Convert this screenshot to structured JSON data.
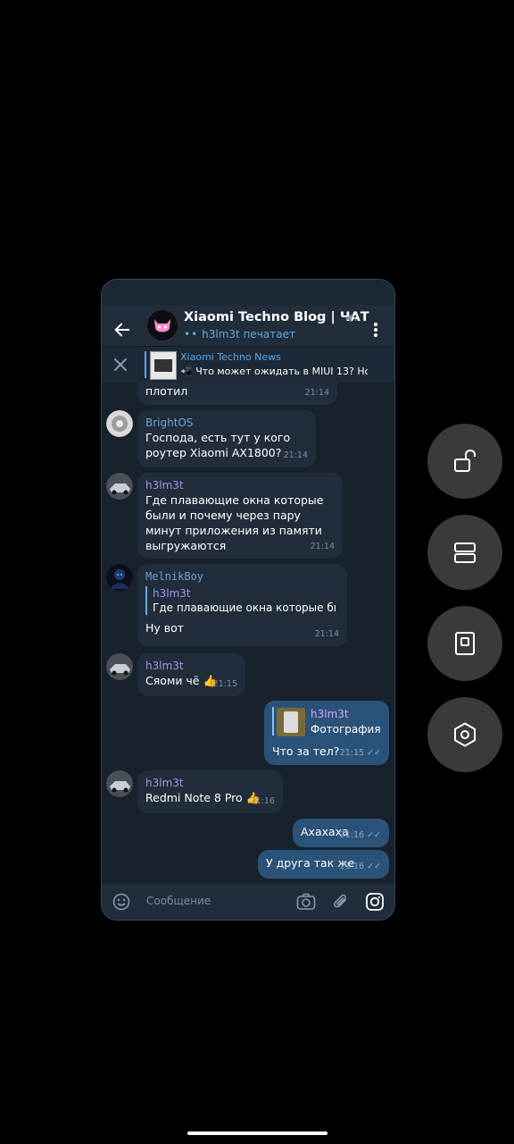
{
  "header": {
    "title": "Xiaomi Techno Blog | ЧАТ",
    "typing_dots": "••",
    "typing_status": "h3lm3t печатает"
  },
  "pinned": {
    "title": "Xiaomi Techno News",
    "text": "📲 Что может ожидать в MIUI 13? Нов..."
  },
  "messages": [
    {
      "text": "плотил",
      "time": "21:14"
    },
    {
      "sender": "BrightOS",
      "text": "Господа, есть тут у кого роутер Xiaomi AX1800?",
      "time": "21:14"
    },
    {
      "sender": "h3lm3t",
      "text": "Где плавающие окна которые были и почему через пару минут приложения из памяти выгружаются",
      "time": "21:14"
    },
    {
      "sender": "MelnikBoy",
      "reply_name": "h3lm3t",
      "reply_text": "Где плавающие окна которые бы...",
      "text": "Ну вот",
      "time": "21:14"
    },
    {
      "sender": "h3lm3t",
      "text": "Сяоми чё 👍",
      "time": "21:15"
    },
    {
      "reply_name": "h3lm3t",
      "reply_text": "Фотография",
      "text": "Что за тел?",
      "time": "21:15",
      "outgoing": true
    },
    {
      "sender": "h3lm3t",
      "text": "Redmi Note 8 Pro 👍",
      "time": "21:16"
    },
    {
      "text": "Ахахаха",
      "time": "21:16",
      "outgoing": true
    },
    {
      "text": "У друга так же",
      "time": "21:16",
      "outgoing": true
    }
  ],
  "input": {
    "placeholder": "Сообщение"
  },
  "colors": {
    "background": "#18222d",
    "header": "#212d3b",
    "incoming_bubble": "#212d3b",
    "outgoing_bubble": "#2b5278",
    "accent": "#5aa5e6",
    "sender_brightos": "#6ba4d8",
    "sender_h3lm3t": "#a695e7",
    "sender_melnikboy": "#6ba4d8"
  },
  "icons": [
    "back-arrow-icon",
    "mute-icon",
    "more-vertical-icon",
    "close-icon",
    "emoji-icon",
    "camera-icon",
    "attach-icon",
    "instagram-icon",
    "unlock-icon",
    "split-screen-icon",
    "floating-window-icon",
    "settings-hexagon-icon"
  ]
}
